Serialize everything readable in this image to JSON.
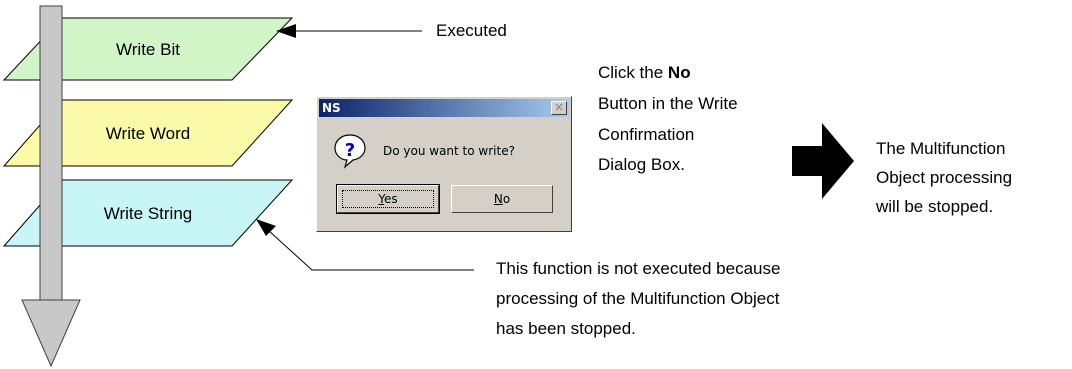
{
  "flow_steps": [
    {
      "label": "Write Bit",
      "fill": "#d2f5c8"
    },
    {
      "label": "Write Word",
      "fill": "#fafaa8"
    },
    {
      "label": "Write String",
      "fill": "#c8f5f5"
    }
  ],
  "annotations": {
    "executed": "Executed",
    "instruction": {
      "line1_prefix": "Click the ",
      "line1_bold": "No",
      "line2": "Button in the Write",
      "line3": "Confirmation",
      "line4": "Dialog Box."
    },
    "result": {
      "line1": "The Multifunction",
      "line2": "Object processing",
      "line3": "will be stopped."
    },
    "not_executed": {
      "line1": "This function is not executed because",
      "line2": "processing of the Multifunction Object",
      "line3": "has been stopped."
    }
  },
  "dialog": {
    "title": "NS",
    "close_glyph": "×",
    "icon": "question-icon",
    "message": "Do you want to write?",
    "yes_mnemonic": "Y",
    "yes_rest": "es",
    "no_mnemonic": "N",
    "no_rest": "o"
  },
  "colors": {
    "arrow_fill": "#c8c8c8",
    "titlebar": "#0a246a",
    "dialog_bg": "#d4d0c8"
  }
}
